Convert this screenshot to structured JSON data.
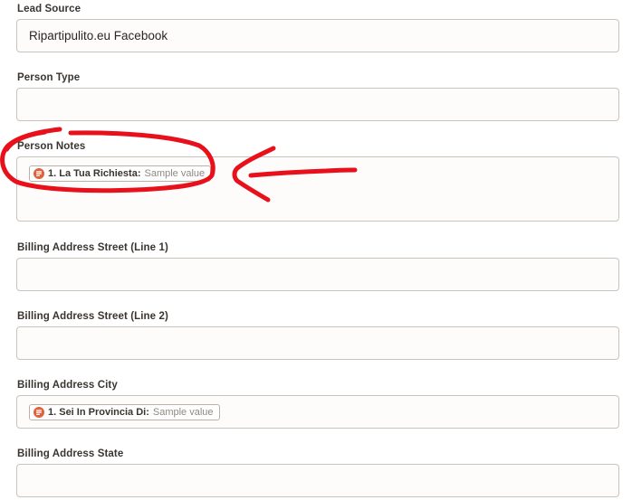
{
  "fields": {
    "lead_source": {
      "label": "Lead Source",
      "value": "Ripartipulito.eu Facebook"
    },
    "person_type": {
      "label": "Person Type",
      "value": ""
    },
    "person_notes": {
      "label": "Person Notes",
      "pill_key": "1. La Tua Richiesta:",
      "pill_value": "Sample value"
    },
    "billing_street_1": {
      "label": "Billing Address Street (Line 1)",
      "value": ""
    },
    "billing_street_2": {
      "label": "Billing Address Street (Line 2)",
      "value": ""
    },
    "billing_city": {
      "label": "Billing Address City",
      "pill_key": "1. Sei In Provincia Di:",
      "pill_value": "Sample value"
    },
    "billing_state": {
      "label": "Billing Address State",
      "value": ""
    }
  },
  "icons": {
    "step_app": "form-app-icon"
  },
  "colors": {
    "annotation": "#e8101a",
    "app_icon": "#e0613a",
    "field_border": "#c9c3bd",
    "label_text": "#3a3530",
    "placeholder": "#8f8882"
  }
}
